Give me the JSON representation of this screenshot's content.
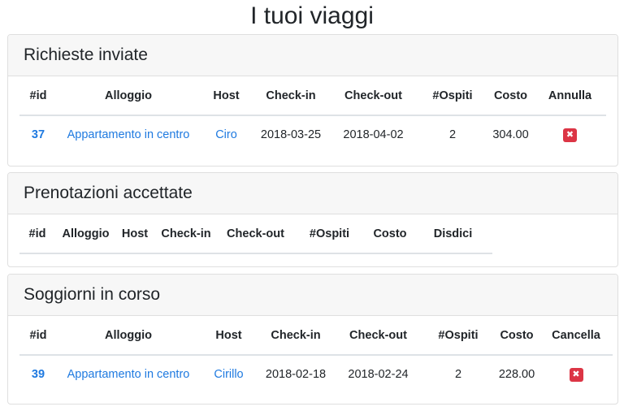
{
  "page": {
    "title": "I tuoi viaggi"
  },
  "icons": {
    "delete": "close-icon",
    "delete_color": "#dc3545",
    "link_color": "#1f7ae0"
  },
  "sections": {
    "sent": {
      "title": "Richieste inviate",
      "columns": [
        "#id",
        "Alloggio",
        "Host",
        "Check-in",
        "Check-out",
        "#Ospiti",
        "Costo",
        "Annulla"
      ],
      "rows": [
        {
          "id": "37",
          "alloggio": "Appartamento in centro",
          "host": "Ciro",
          "checkin": "2018-03-25",
          "checkout": "2018-04-02",
          "ospiti": "2",
          "costo": "304.00",
          "action": "✖"
        }
      ]
    },
    "accepted": {
      "title": "Prenotazioni accettate",
      "columns": [
        "#id",
        "Alloggio",
        "Host",
        "Check-in",
        "Check-out",
        "#Ospiti",
        "Costo",
        "Disdici"
      ],
      "rows": []
    },
    "current": {
      "title": "Soggiorni in corso",
      "columns": [
        "#id",
        "Alloggio",
        "Host",
        "Check-in",
        "Check-out",
        "#Ospiti",
        "Costo",
        "Cancella"
      ],
      "rows": [
        {
          "id": "39",
          "alloggio": "Appartamento in centro",
          "host": "Cirillo",
          "checkin": "2018-02-18",
          "checkout": "2018-02-24",
          "ospiti": "2",
          "costo": "228.00",
          "action": "✖"
        }
      ]
    }
  }
}
